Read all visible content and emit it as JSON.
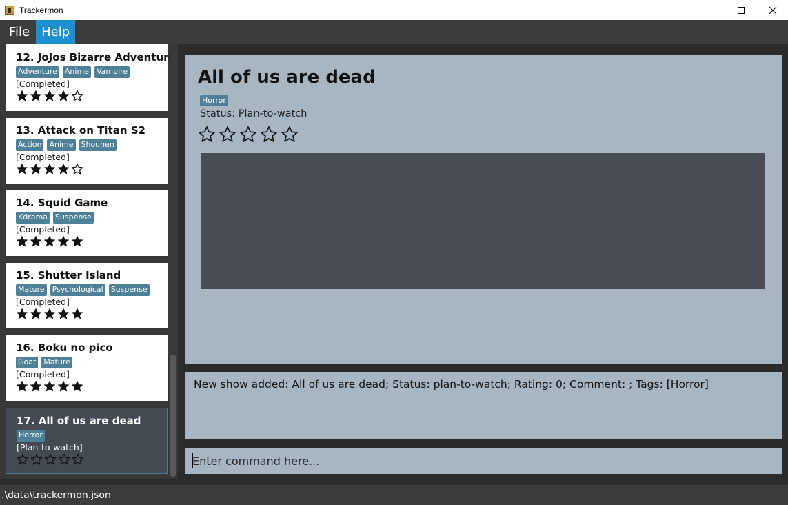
{
  "window": {
    "title": "Trackermon"
  },
  "menu": {
    "items": [
      {
        "label": "File"
      },
      {
        "label": "Help"
      }
    ]
  },
  "shows": [
    {
      "index": "12.",
      "name": "JoJos Bizarre Adventure",
      "tags": [
        "Adventure",
        "Anime",
        "Vampire"
      ],
      "status": "[Completed]",
      "rating": 4
    },
    {
      "index": "13.",
      "name": "Attack on Titan S2",
      "tags": [
        "Action",
        "Anime",
        "Shounen"
      ],
      "status": "[Completed]",
      "rating": 4
    },
    {
      "index": "14.",
      "name": "Squid Game",
      "tags": [
        "Kdrama",
        "Suspense"
      ],
      "status": "[Completed]",
      "rating": 5
    },
    {
      "index": "15.",
      "name": "Shutter Island",
      "tags": [
        "Mature",
        "Psychological",
        "Suspense"
      ],
      "status": "[Completed]",
      "rating": 5
    },
    {
      "index": "16.",
      "name": "Boku no pico",
      "tags": [
        "Goat",
        "Mature"
      ],
      "status": "[Completed]",
      "rating": 5
    },
    {
      "index": "17.",
      "name": "All of us are dead",
      "tags": [
        "Horror"
      ],
      "status": "[Plan-to-watch]",
      "rating": 0
    }
  ],
  "detail": {
    "title": "All of us are dead",
    "tag": "Horror",
    "status": "Status: Plan-to-watch",
    "rating": 0
  },
  "result": {
    "text": "New show added: All of us are dead; Status: plan-to-watch; Rating: 0; Comment: ; Tags: [Horror]"
  },
  "command": {
    "placeholder": "Enter command here..."
  },
  "statusbar": {
    "path": ".\\data\\trackermon.json"
  },
  "colors": {
    "accent": "#1e8fcf",
    "tag": "#4e8197",
    "panel": "#a7b6c1",
    "selected_card": "#454b53"
  }
}
